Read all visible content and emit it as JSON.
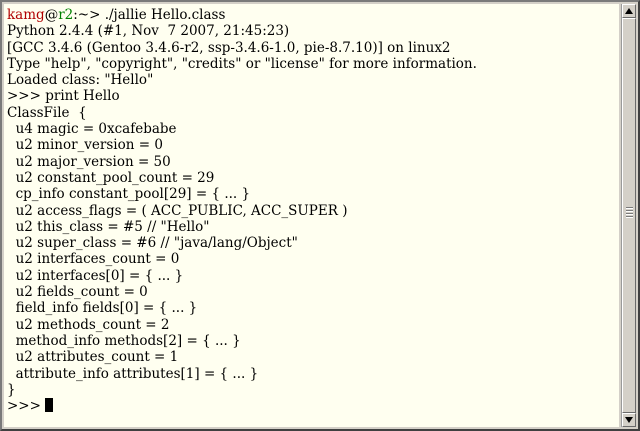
{
  "terminal": {
    "prompt_line": {
      "user": "kamg",
      "at": "@",
      "host": "r2",
      "rest": ":~> ./jallie Hello.class"
    },
    "output_lines": [
      "Python 2.4.4 (#1, Nov  7 2007, 21:45:23)",
      "[GCC 3.4.6 (Gentoo 3.4.6-r2, ssp-3.4.6-1.0, pie-8.7.10)] on linux2",
      "Type \"help\", \"copyright\", \"credits\" or \"license\" for more information.",
      "Loaded class: \"Hello\"",
      ">>> print Hello",
      "ClassFile  {",
      "  u4 magic = 0xcafebabe",
      "  u2 minor_version = 0",
      "  u2 major_version = 50",
      "  u2 constant_pool_count = 29",
      "  cp_info constant_pool[29] = { ... }",
      "  u2 access_flags = ( ACC_PUBLIC, ACC_SUPER )",
      "  u2 this_class = #5 // \"Hello\"",
      "  u2 super_class = #6 // \"java/lang/Object\"",
      "  u2 interfaces_count = 0",
      "  u2 interfaces[0] = { ... }",
      "  u2 fields_count = 0",
      "  field_info fields[0] = { ... }",
      "  u2 methods_count = 2",
      "  method_info methods[2] = { ... }",
      "  u2 attributes_count = 1",
      "  attribute_info attributes[1] = { ... }",
      "}"
    ],
    "current_prompt": ">>> ",
    "colors": {
      "background": "#fffff0",
      "user": "#b00000",
      "host": "#008000"
    }
  },
  "scrollbar": {
    "up_icon": "arrow-up-icon",
    "down_icon": "arrow-down-icon"
  }
}
